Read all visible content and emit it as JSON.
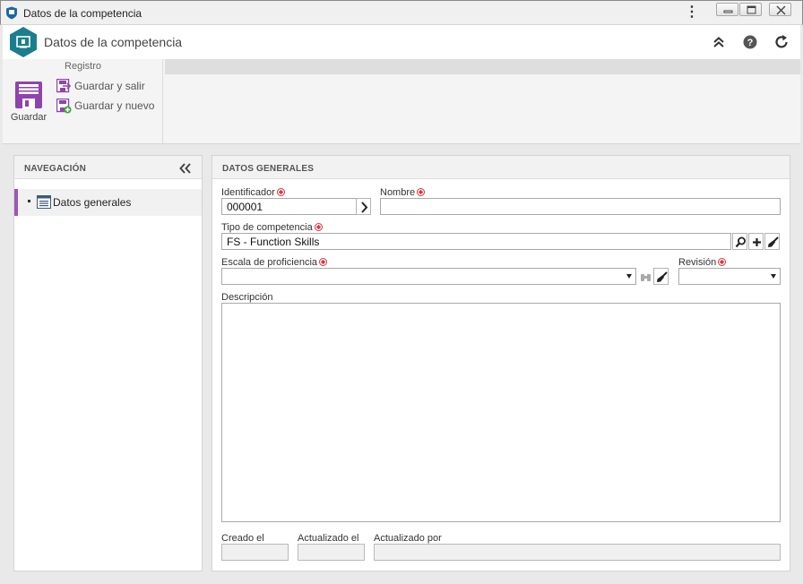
{
  "window": {
    "title": "Datos de la competencia"
  },
  "header": {
    "title": "Datos de la competencia"
  },
  "ribbon": {
    "group_label": "Registro",
    "save_label": "Guardar",
    "save_exit_label": "Guardar y salir",
    "save_new_label": "Guardar y nuevo"
  },
  "nav": {
    "title": "NAVEGACIÓN",
    "items": [
      {
        "label": "Datos generales"
      }
    ]
  },
  "form": {
    "title": "DATOS GENERALES",
    "identificador": {
      "label": "Identificador",
      "value": "000001"
    },
    "nombre": {
      "label": "Nombre",
      "value": ""
    },
    "tipo": {
      "label": "Tipo de competencia",
      "value": "FS - Function Skills"
    },
    "escala": {
      "label": "Escala de proficiencia",
      "value": ""
    },
    "revision": {
      "label": "Revisión",
      "value": ""
    },
    "descripcion": {
      "label": "Descripción"
    },
    "creado": {
      "label": "Creado el",
      "value": ""
    },
    "actualizado": {
      "label": "Actualizado el",
      "value": ""
    },
    "actualizado_por": {
      "label": "Actualizado por",
      "value": ""
    }
  },
  "colors": {
    "accent": "#8e44ad",
    "logo": "#1b7e8f",
    "required": "#e0343c"
  }
}
